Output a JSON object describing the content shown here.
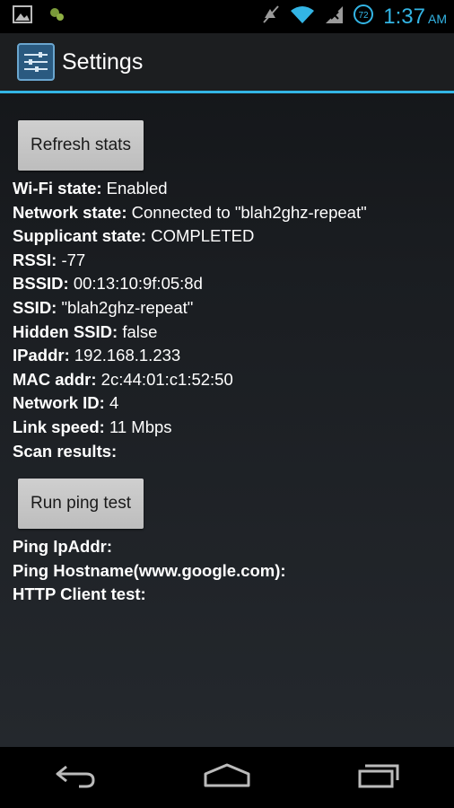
{
  "status_bar": {
    "time": "1:37",
    "ampm": "AM",
    "battery_level": "72"
  },
  "action_bar": {
    "title": "Settings"
  },
  "buttons": {
    "refresh": "Refresh stats",
    "ping": "Run ping test"
  },
  "wifi_info": [
    {
      "label": "Wi-Fi state:",
      "value": "Enabled"
    },
    {
      "label": "Network state:",
      "value": "Connected to \"blah2ghz-repeat\""
    },
    {
      "label": "Supplicant state:",
      "value": "COMPLETED"
    },
    {
      "label": "RSSI:",
      "value": "-77"
    },
    {
      "label": "BSSID:",
      "value": "00:13:10:9f:05:8d"
    },
    {
      "label": "SSID:",
      "value": "\"blah2ghz-repeat\""
    },
    {
      "label": "Hidden SSID:",
      "value": "false"
    },
    {
      "label": "IPaddr:",
      "value": "192.168.1.233"
    },
    {
      "label": "MAC addr:",
      "value": "2c:44:01:c1:52:50"
    },
    {
      "label": "Network ID:",
      "value": "4"
    },
    {
      "label": "Link speed:",
      "value": "11 Mbps"
    },
    {
      "label": "Scan results:",
      "value": ""
    }
  ],
  "ping_info": [
    {
      "label": "Ping IpAddr:",
      "value": ""
    },
    {
      "label": "Ping Hostname(www.google.com):",
      "value": ""
    },
    {
      "label": "HTTP Client test:",
      "value": ""
    }
  ],
  "colors": {
    "accent": "#33b5e5",
    "button": "#c8c8c8",
    "background": "#1a1d21"
  }
}
